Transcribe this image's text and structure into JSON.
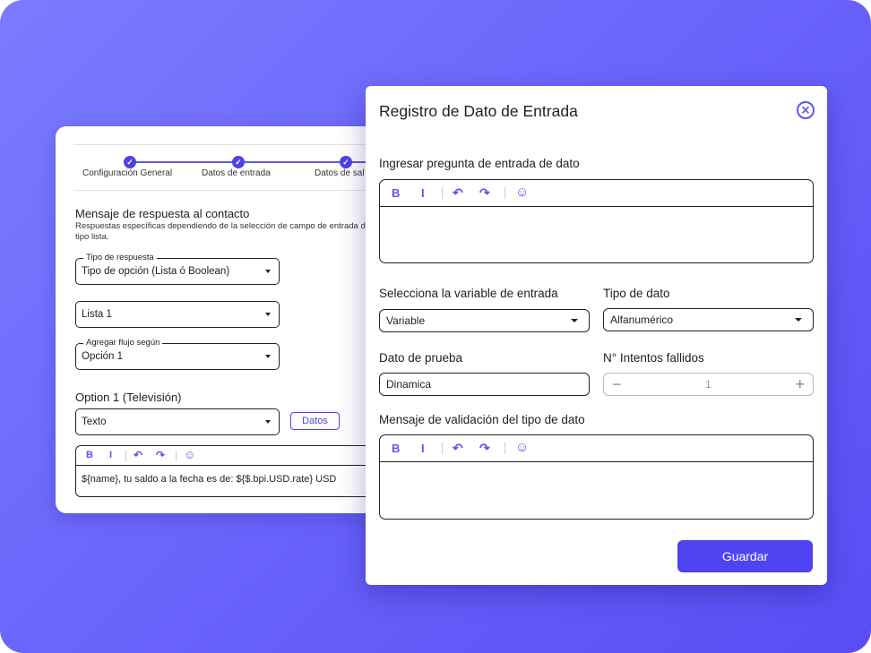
{
  "background_card": {
    "steps": [
      {
        "label": "Configuración General",
        "check": "✓"
      },
      {
        "label": "Datos de entrada",
        "check": "✓"
      },
      {
        "label": "Datos de sal",
        "check": "✓"
      }
    ],
    "title": "Mensaje de respuesta al contacto",
    "subtitle": "Respuestas específicas dependiendo de la selección de campo de entrada de tipo lista.",
    "tipo_respuesta": {
      "legend": "Tipo de respuesta",
      "value": "Tipo de opción (Lista ó Boolean)"
    },
    "lista": {
      "value": "Lista 1"
    },
    "agregar_flujo": {
      "legend": "Agregar flujo según",
      "value": "Opción 1"
    },
    "option_title": "Option 1 (Televisión)",
    "texto_select": {
      "value": "Texto"
    },
    "datos_button": "Datos",
    "editor": {
      "bold": "B",
      "italic": "I",
      "content": "${name}, tu saldo a la fecha es de: ${$.bpi.USD.rate} USD"
    }
  },
  "modal": {
    "title": "Registro de Dato de Entrada",
    "close_icon": "⨯",
    "question_label": "Ingresar pregunta de entrada de dato",
    "toolbar": {
      "bold": "B",
      "italic": "I",
      "undo": "↶",
      "redo": "↷",
      "emoji": "☺"
    },
    "variable_label": "Selecciona la variable de entrada",
    "variable_value": "Variable",
    "tipo_dato_label": "Tipo de dato",
    "tipo_dato_value": "Alfanumérico",
    "dato_prueba_label": "Dato de prueba",
    "dato_prueba_value": "Dinamica",
    "intentos_label": "N° Intentos fallidos",
    "intentos_value": "1",
    "minus": "−",
    "plus": "+",
    "validacion_label": "Mensaje de validación del tipo de dato",
    "save_label": "Guardar"
  },
  "colors": {
    "accent": "#4f43f2",
    "background_gradient_start": "#7b7bff",
    "background_gradient_end": "#5a4cf5"
  }
}
